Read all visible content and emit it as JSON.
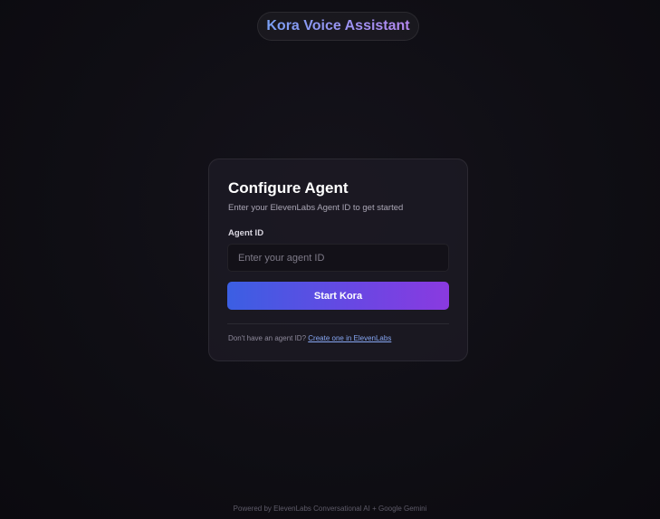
{
  "header": {
    "title": "Kora Voice Assistant"
  },
  "card": {
    "title": "Configure Agent",
    "subtitle": "Enter your ElevenLabs Agent ID to get started",
    "field_label": "Agent ID",
    "input_value": "",
    "input_placeholder": "Enter your agent ID",
    "button_label": "Start Kora",
    "help_text": "Don't have an agent ID? ",
    "help_link": "Create one in ElevenLabs"
  },
  "footer": {
    "powered_by": "Powered by ElevenLabs Conversational AI + Google Gemini"
  },
  "colors": {
    "background": "#0f0e14",
    "card": "#1e1b26",
    "accent_start": "#3b5fe3",
    "accent_end": "#8a3ae0",
    "link": "#86a6f2"
  }
}
